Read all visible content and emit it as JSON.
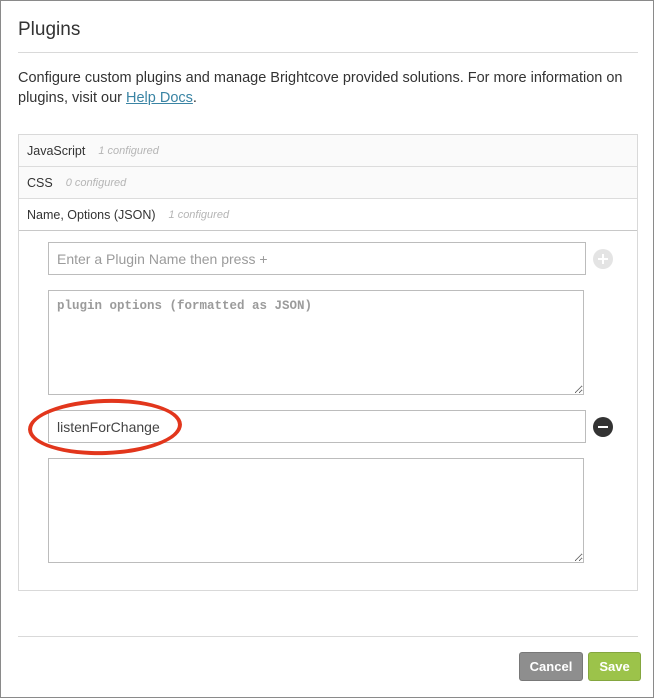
{
  "dialog": {
    "title": "Plugins",
    "description_prefix": "Configure custom plugins and manage Brightcove provided solutions. For more information on plugins, visit our ",
    "help_link": "Help Docs",
    "description_suffix": "."
  },
  "tabs": [
    {
      "name": "JavaScript",
      "count": "1 configured"
    },
    {
      "name": "CSS",
      "count": "0 configured"
    },
    {
      "name": "Name, Options (JSON)",
      "count": "1 configured"
    }
  ],
  "new_plugin": {
    "name_placeholder": "Enter a Plugin Name then press +",
    "options_placeholder": "plugin options (formatted as JSON)"
  },
  "configured_plugin": {
    "name": "listenForChange",
    "options": ""
  },
  "icons": {
    "add": "plus-circle-icon",
    "remove": "minus-circle-icon"
  },
  "footer": {
    "cancel_label": "Cancel",
    "save_label": "Save"
  },
  "colors": {
    "link": "#3a84a4",
    "save": "#9cc34a",
    "cancel": "#8e8e8e",
    "highlight": "#e2361c"
  }
}
